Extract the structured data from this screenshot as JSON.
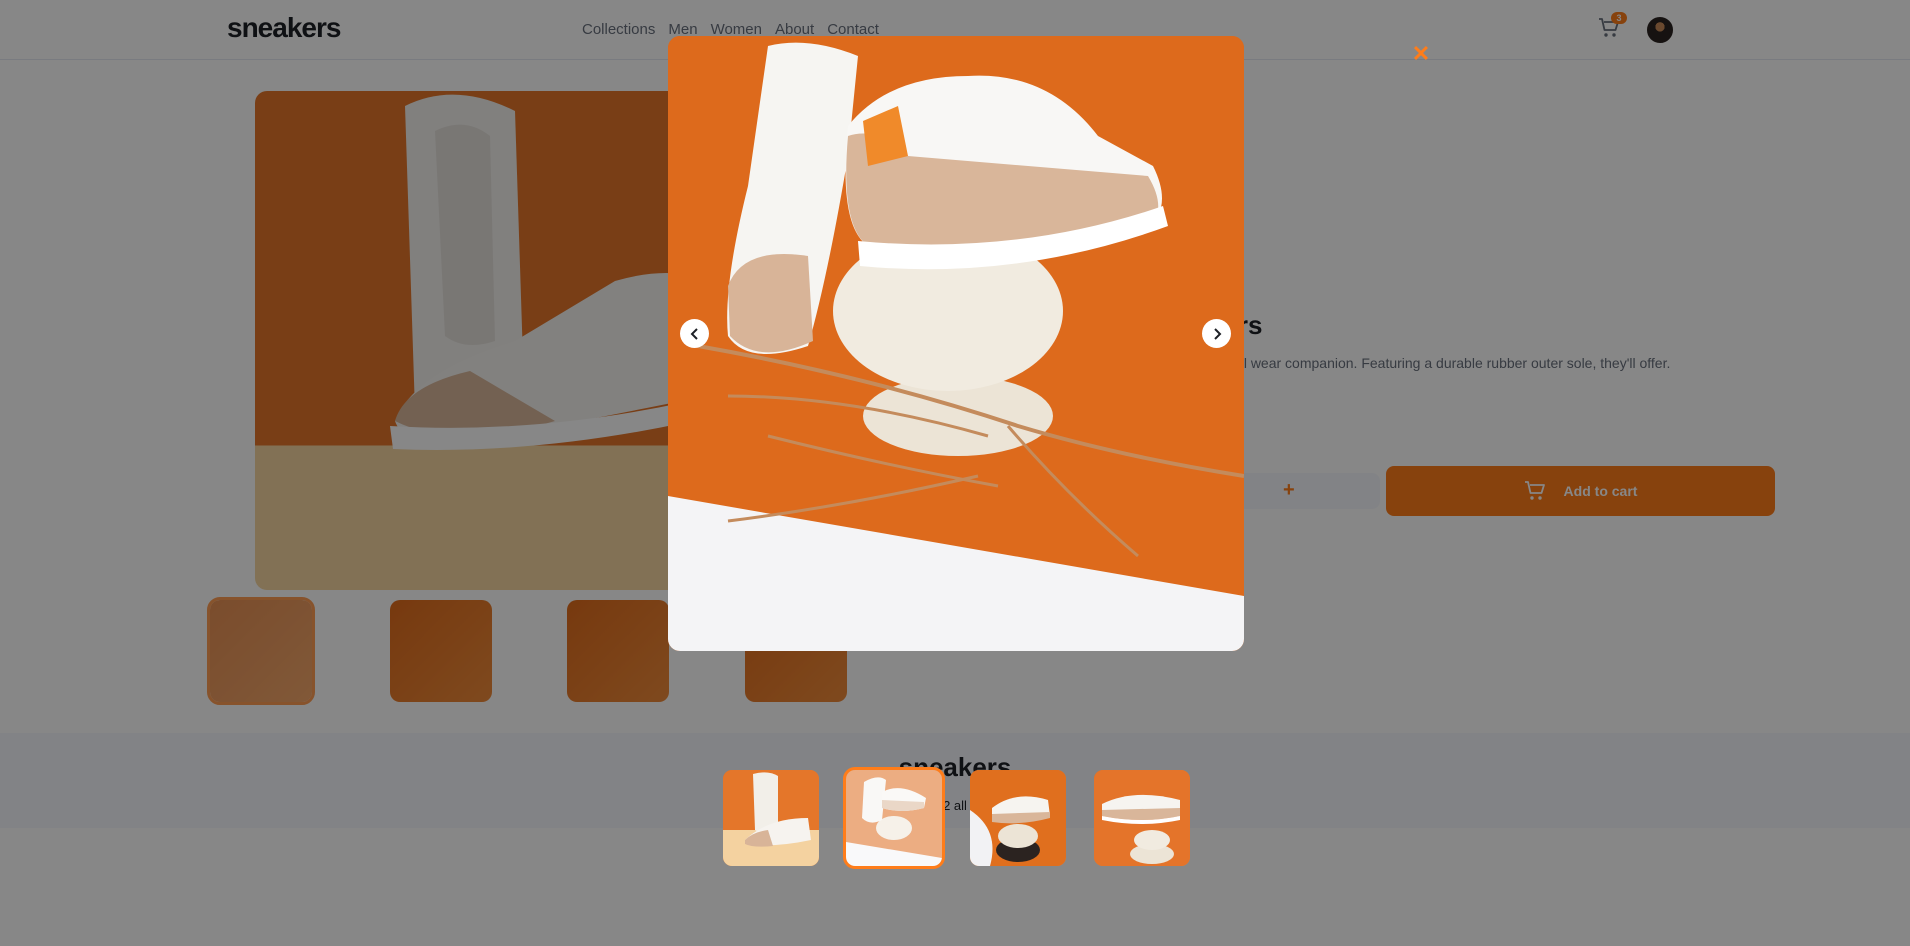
{
  "header": {
    "logo": "sneakers",
    "nav_items": [
      "Collections",
      "Men",
      "Women",
      "About",
      "Contact"
    ],
    "cart_count": "3"
  },
  "product": {
    "title": "eakers",
    "description": "fect casual wear companion. Featuring a durable rubber outer sole, they'll offer.",
    "quantity_plus": "+",
    "add_to_cart_label": "Add to cart"
  },
  "footer": {
    "title": "sneakers",
    "text": "2 all"
  },
  "lightbox": {
    "close_glyph": "✕",
    "active_index": 1,
    "thumbnails": [
      "image-product-1",
      "image-product-2",
      "image-product-3",
      "image-product-4"
    ]
  },
  "colors": {
    "accent": "#ff7d1a",
    "dark": "#1d2026",
    "muted": "#69707d",
    "product_orange": "#e4762a"
  },
  "icons": {
    "cart": "cart-icon",
    "close": "close-icon",
    "previous": "chevron-left-icon",
    "next": "chevron-right-icon"
  }
}
